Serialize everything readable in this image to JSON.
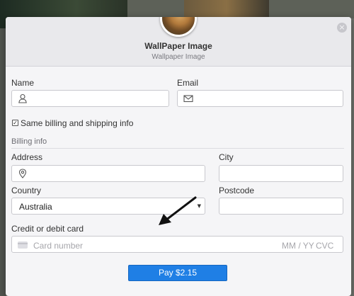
{
  "header": {
    "title": "WallPaper Image",
    "subtitle": "Wallpaper Image",
    "close_icon": "close-icon"
  },
  "form": {
    "name_label": "Name",
    "email_label": "Email",
    "same_info_label": "Same billing and shipping info",
    "same_info_checked": true,
    "billing_section_title": "Billing info",
    "address_label": "Address",
    "city_label": "City",
    "country_label": "Country",
    "country_value": "Australia",
    "postcode_label": "Postcode",
    "card_label": "Credit or debit card",
    "card_placeholder": "Card number",
    "card_expiry_placeholder": "MM / YY",
    "card_cvc_placeholder": "CVC",
    "icons": {
      "name": "user-icon",
      "email": "envelope-icon",
      "address": "map-pin-icon",
      "card": "credit-card-icon"
    }
  },
  "pay_button": {
    "label": "Pay $2.15",
    "color": "#1f7fe5"
  }
}
